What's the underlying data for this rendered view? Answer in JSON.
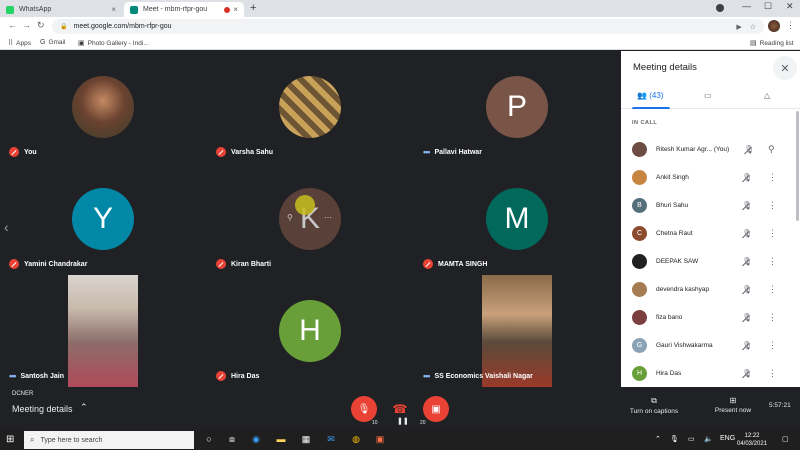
{
  "browser": {
    "tabs": [
      {
        "title": "WhatsApp",
        "close": "×"
      },
      {
        "title": "Meet - mbm-rfpr-gou",
        "close": "×"
      }
    ],
    "new_tab": "+",
    "window_controls": [
      "—",
      "☐",
      "✕"
    ],
    "nav": {
      "back": "←",
      "forward": "→",
      "reload": "↻"
    },
    "url": "meet.google.com/mbm-rfpr-gou",
    "bookmarks": [
      {
        "icon": "⠿",
        "label": "Apps"
      },
      {
        "icon": "G",
        "label": "Gmail"
      },
      {
        "icon": "▣",
        "label": "Photo Gallery - Indi..."
      }
    ],
    "reading_list": "Reading list"
  },
  "stage": {
    "tiles": [
      {
        "name": "You",
        "status": "muted",
        "avatar": "photo",
        "color": "#5b4636"
      },
      {
        "name": "Varsha Sahu",
        "status": "muted",
        "avatar": "photo",
        "color": "#b08a4a"
      },
      {
        "name": "Pallavi Hatwar",
        "status": "speaking",
        "avatar": "P",
        "color": "#795548"
      },
      {
        "name": "Yamini Chandrakar",
        "status": "muted",
        "avatar": "Y",
        "color": "#0288a7"
      },
      {
        "name": "Kiran Bharti",
        "status": "muted",
        "avatar": "K",
        "color": "#6d4c41"
      },
      {
        "name": "MAMTA SINGH",
        "status": "muted",
        "avatar": "M",
        "color": "#00695c"
      },
      {
        "name": "Santosh Jain",
        "status": "speaking",
        "avatar": "video",
        "color": "#8c6d6a"
      },
      {
        "name": "Hira Das",
        "status": "muted",
        "avatar": "H",
        "color": "#689f38"
      },
      {
        "name": "SS Economics Vaishali Nagar",
        "status": "speaking",
        "avatar": "video",
        "color": "#a4764c"
      }
    ],
    "hover_icons": {
      "pin": "⚲",
      "more": "⋯"
    }
  },
  "panel": {
    "title": "Meeting details",
    "close": "✕",
    "people_count": "(43)",
    "section": "IN CALL",
    "participants": [
      {
        "name": "Ritesh Kumar Agr...",
        "you": "(You)",
        "initial": "",
        "color": "#6d4c41"
      },
      {
        "name": "Ankit Singh",
        "initial": "",
        "color": "#c68642"
      },
      {
        "name": "Bhuri Sahu",
        "initial": "B",
        "color": "#546e7a"
      },
      {
        "name": "Chetna Raut",
        "initial": "C",
        "color": "#8d4b2e"
      },
      {
        "name": "DEEPAK SAW",
        "initial": "",
        "color": "#212121"
      },
      {
        "name": "devendra kashyap",
        "initial": "",
        "color": "#a67c52"
      },
      {
        "name": "fiza bano",
        "initial": "",
        "color": "#7b3f3f"
      },
      {
        "name": "Gauri Vishwakarma",
        "initial": "G",
        "color": "#8aa2b5"
      },
      {
        "name": "Hira Das",
        "initial": "H",
        "color": "#689f38"
      }
    ]
  },
  "bottombar": {
    "title": "Meeting details",
    "chevron": "⌃",
    "presenter_label": "DCNER",
    "mic_sub": "10",
    "cam_sub": "20",
    "captions": "Turn on captions",
    "present": "Present now",
    "time": "5:57:21"
  },
  "taskbar": {
    "search_placeholder": "Type here to search",
    "lang": "ENG",
    "time": "12:22",
    "date": "04/03/2021"
  }
}
